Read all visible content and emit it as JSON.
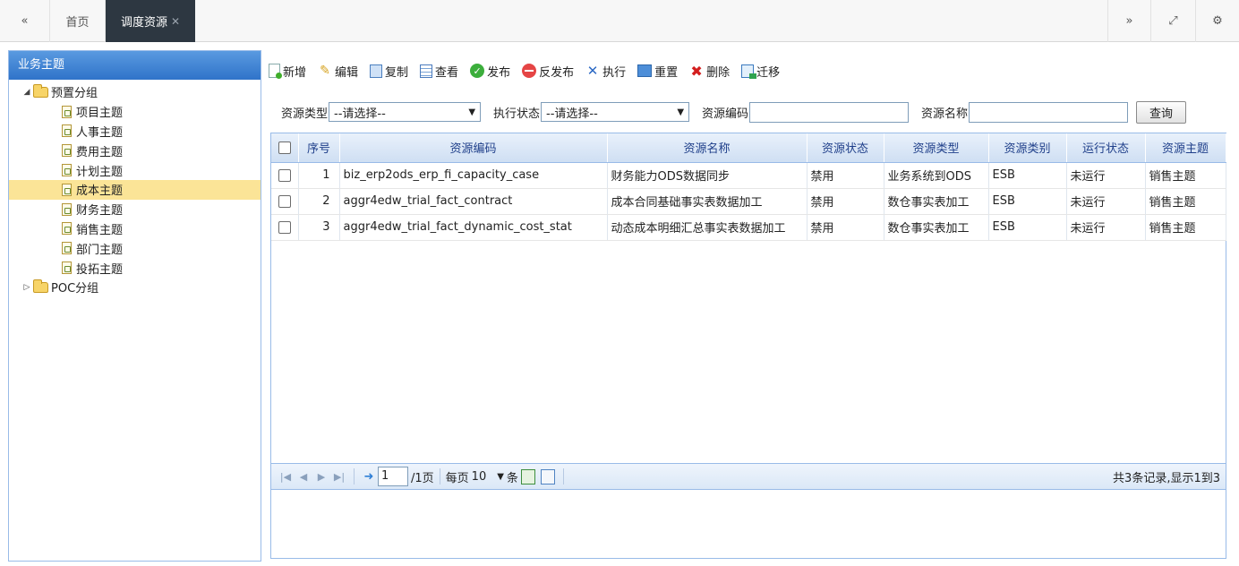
{
  "tabs": {
    "first_btn": "«",
    "home": "首页",
    "active": "调度资源",
    "active_close": "✕",
    "last_btn": "»",
    "fullscreen_btn": "⤢",
    "settings_btn": "⚙"
  },
  "sidebar": {
    "title": "业务主题",
    "groups": [
      {
        "label": "预置分组",
        "expanded": true,
        "items": [
          "项目主题",
          "人事主题",
          "费用主题",
          "计划主题",
          "成本主题",
          "财务主题",
          "销售主题",
          "部门主题",
          "投拓主题"
        ],
        "selected": "成本主题"
      },
      {
        "label": "POC分组",
        "expanded": false,
        "items": []
      }
    ]
  },
  "toolbar": [
    "新增",
    "编辑",
    "复制",
    "查看",
    "发布",
    "反发布",
    "执行",
    "重置",
    "删除",
    "迁移"
  ],
  "filters": {
    "type_label": "资源类型",
    "type_value": "--请选择--",
    "exec_label": "执行状态",
    "exec_value": "--请选择--",
    "code_label": "资源编码",
    "name_label": "资源名称",
    "query_btn": "查询"
  },
  "table": {
    "headers": [
      "序号",
      "资源编码",
      "资源名称",
      "资源状态",
      "资源类型",
      "资源类别",
      "运行状态",
      "资源主题"
    ],
    "rows": [
      [
        "1",
        "biz_erp2ods_erp_fi_capacity_case",
        "财务能力ODS数据同步",
        "禁用",
        "业务系统到ODS",
        "ESB",
        "未运行",
        "销售主题"
      ],
      [
        "2",
        "aggr4edw_trial_fact_contract",
        "成本合同基础事实表数据加工",
        "禁用",
        "数仓事实表加工",
        "ESB",
        "未运行",
        "销售主题"
      ],
      [
        "3",
        "aggr4edw_trial_fact_dynamic_cost_stat",
        "动态成本明细汇总事实表数据加工",
        "禁用",
        "数仓事实表加工",
        "ESB",
        "未运行",
        "销售主题"
      ]
    ]
  },
  "pager": {
    "page_value": "1",
    "page_total": "/1页",
    "per_page_label": "每页",
    "per_page_value": "10",
    "per_page_unit": "条",
    "info": "共3条记录,显示1到3"
  }
}
